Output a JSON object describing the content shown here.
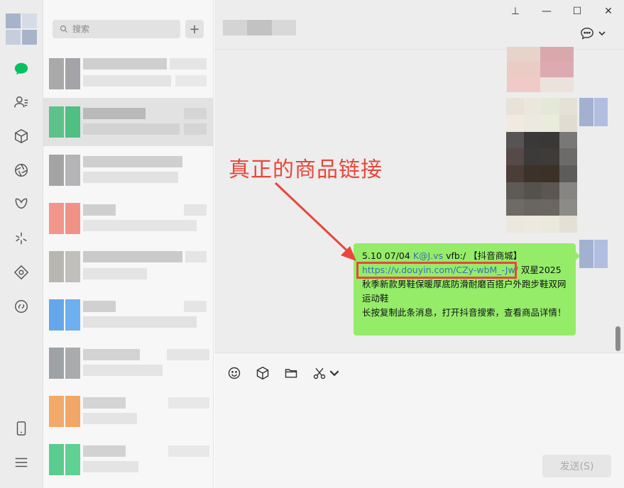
{
  "search": {
    "placeholder": "搜索"
  },
  "list": {
    "add_label": "+"
  },
  "chat": {
    "message_lines": [
      "5.10 07/04 ",
      "K@J.vs",
      " vfb:/ 【抖音商城】",
      "https://v.douyin.com/CZy-wbM_-Jw/",
      " 双星2025秋季新款男鞋保暖厚底防滑耐磨百搭户外跑步鞋双网运动鞋",
      "长按复制此条消息，打开抖音搜索，查看商品详情！"
    ]
  },
  "annotation": {
    "text": "真正的商品链接"
  },
  "composer": {
    "send_label": "发送(S)"
  },
  "window": {
    "pin": "⊥",
    "minimize": "—",
    "maximize": "☐",
    "close": "✕"
  },
  "colors": {
    "bubble": "#95ec69",
    "annotation": "#e8473a",
    "link": "#3b6db5",
    "rail_chat_icon": "#07c160"
  }
}
